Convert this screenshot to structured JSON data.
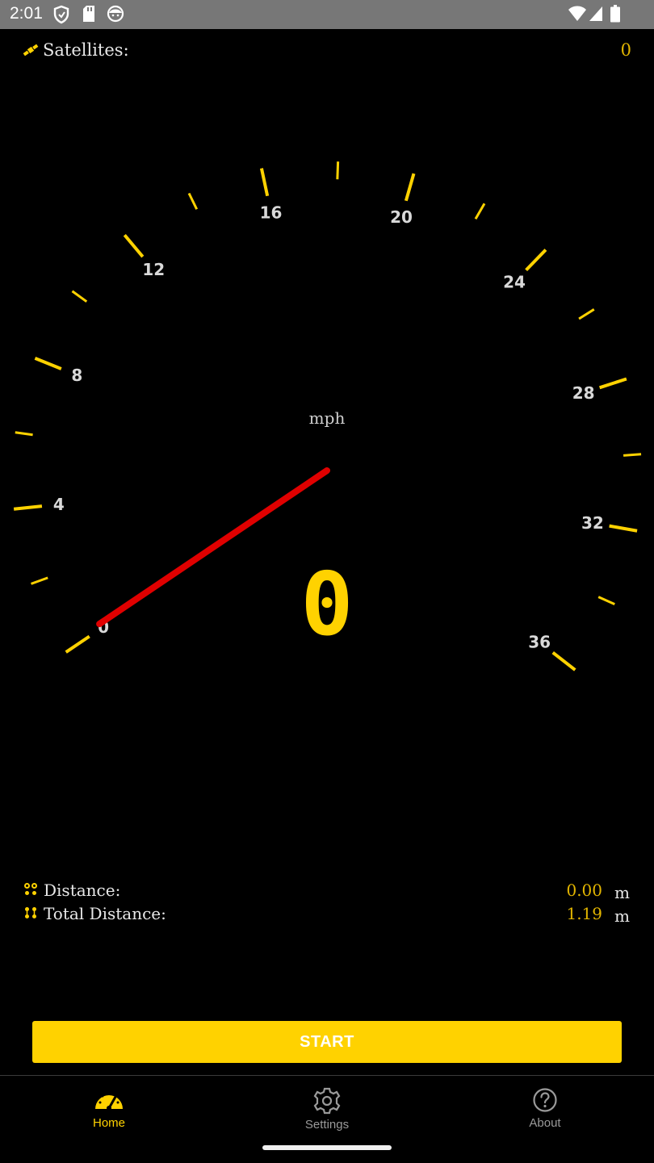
{
  "status_bar": {
    "time": "2:01",
    "icons": [
      "shield-icon",
      "sd-card-icon",
      "face-icon",
      "wifi-icon",
      "signal-icon",
      "battery-icon"
    ]
  },
  "satellites": {
    "label": "Satellites:",
    "value": "0",
    "icon": "satellite-icon"
  },
  "gauge": {
    "unit": "mph",
    "speed": "0",
    "min": 0,
    "max": 36,
    "needle_value": 0,
    "tick_labels": [
      "0",
      "4",
      "8",
      "12",
      "16",
      "20",
      "24",
      "28",
      "32",
      "36"
    ],
    "tick_color": "#FFD200",
    "needle_color": "#E00000"
  },
  "distance": {
    "label": "Distance:",
    "value": "0.00",
    "unit": "m",
    "icon": "distance-icon"
  },
  "total_distance": {
    "label": "Total Distance:",
    "value": "1.19",
    "unit": "m",
    "icon": "total-distance-icon"
  },
  "start_button": {
    "label": "START",
    "color": "#FFD200"
  },
  "nav": {
    "items": [
      {
        "label": "Home",
        "icon": "speedometer-icon",
        "active": true
      },
      {
        "label": "Settings",
        "icon": "gear-icon",
        "active": false
      },
      {
        "label": "About",
        "icon": "help-circle-icon",
        "active": false
      }
    ],
    "active_color": "#FFD200",
    "inactive_color": "#9a9a9a"
  }
}
